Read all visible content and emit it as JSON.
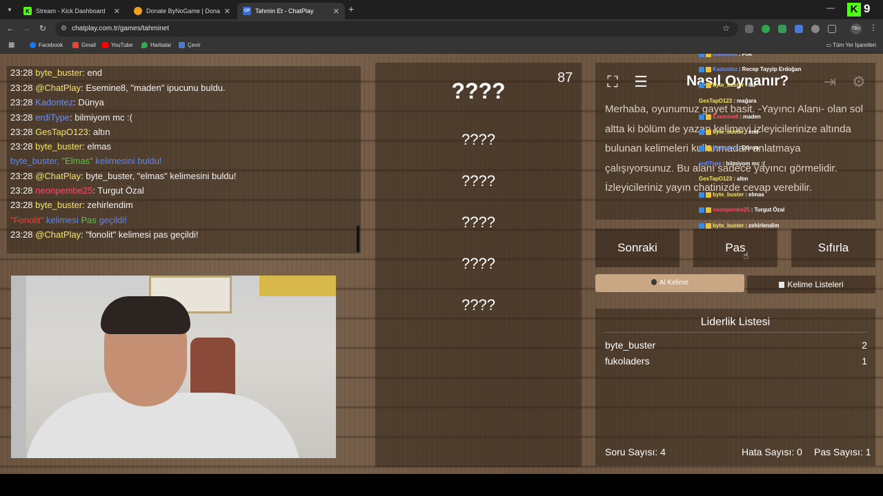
{
  "browser": {
    "tabs": [
      {
        "title": "Stream - Kick Dashboard",
        "icon": "kick-icon",
        "color": "#53fc18",
        "glyph": "K"
      },
      {
        "title": "Donate ByNoGame | Donations",
        "icon": "bynogame-icon",
        "color": "#f0a020",
        "glyph": ""
      },
      {
        "title": "Tahmin Et - ChatPlay",
        "icon": "chatplay-icon",
        "color": "#3a6ad8",
        "glyph": "CP"
      }
    ],
    "new_tab": "+",
    "url": "chatplay.com.tr/games/tahminet",
    "kick_count": "9",
    "profile": "TBU",
    "bookmarks": [
      "Facebook",
      "Gmail",
      "YouTube",
      "Haritalar",
      "Çevir"
    ],
    "all_bookmarks": "Tüm Yer İşaretleri"
  },
  "chat": {
    "lines": [
      {
        "time": "23:28",
        "user": "byte_buster",
        "text": ": end"
      },
      {
        "time": "23:28",
        "user": "@ChatPlay",
        "text": ": Esemine8, \"maden\" ipucunu buldu."
      },
      {
        "time": "23:28",
        "user": "Kadontez",
        "text": ": Dünya"
      },
      {
        "time": "23:28",
        "user": "erdiType",
        "text": ": bilmiyom mc :("
      },
      {
        "time": "23:28",
        "user": "GesTapO123",
        "text": ": altın"
      },
      {
        "time": "23:28",
        "user": "byte_buster",
        "text": ": elmas"
      },
      {
        "time": "",
        "user": "byte_buster, ",
        "text": "kelimesini buldu!",
        "word": "\"Elmas\""
      },
      {
        "time": "23:28",
        "user": "@ChatPlay",
        "text": ": byte_buster, \"elmas\" kelimesini buldu!"
      },
      {
        "time": "23:28",
        "user": "neonpembe25",
        "text": ": Turgut Özal"
      },
      {
        "time": "23:28",
        "user": "byte_buster",
        "text": ": zehirlendim"
      },
      {
        "time": "",
        "user": "\"Fonolit\"",
        "text": "geçildi!",
        "mid": "kelimesi",
        "word": "Pas"
      },
      {
        "time": "23:28",
        "user": "@ChatPlay",
        "text": ": \"fonolit\" kelimesi pas geçildi!"
      }
    ]
  },
  "game": {
    "counter": "87",
    "hidden_words": [
      "????",
      "????",
      "????",
      "????",
      "????",
      "????"
    ],
    "how_title": "Nasıl Oynanır?",
    "how_text": "Merhaba, oyunumuz gayet basit. -Yayıncı Alanı- olan sol altta ki bölüm de yazan kelimeyi izleyicilerinize altında bulunan kelimeleri kullanmadan anlatmaya çalışıyorsunuz. Bu alanı sadece yayıncı görmelidir. İzleyicileriniz yayın chatinizde cevap verebilir.",
    "buttons": {
      "next": "Sonraki",
      "pass": "Pas",
      "reset": "Sıfırla"
    },
    "get_word": "Al Kelime",
    "word_lists": "Kelime Listeleri"
  },
  "leaderboard": {
    "title": "Liderlik Listesi",
    "rows": [
      {
        "name": "byte_buster",
        "score": "2"
      },
      {
        "name": "fukoladers",
        "score": "1"
      }
    ],
    "stats": {
      "questions": "Soru Sayısı: 4",
      "errors": "Hata Sayısı: 0",
      "passes": "Pas Sayısı: 1"
    }
  },
  "overlay": [
    {
      "user": "Kadontez",
      "text": "Fok",
      "color": "#6a8ff0"
    },
    {
      "user": "Kadontez",
      "text": "Recep Tayyip Erdoğan",
      "color": "#6a8ff0"
    },
    {
      "user": "byte_buster",
      "text": "itu",
      "color": "#f2e56a"
    },
    {
      "user": "GesTapO123",
      "text": "mağara",
      "color": "#f2e56a"
    },
    {
      "user": "Esemine8",
      "text": "maden",
      "color": "#ff4a6a"
    },
    {
      "user": "byte_buster",
      "text": "end",
      "color": "#f2e56a"
    },
    {
      "user": "Kadontez",
      "text": "Dünya",
      "color": "#6a8ff0"
    },
    {
      "user": "erdiType",
      "text": "bilmiyom mc :(",
      "color": "#6a8ff0"
    },
    {
      "user": "GesTapO123",
      "text": "altın",
      "color": "#f2e56a"
    },
    {
      "user": "byte_buster",
      "text": "elmas",
      "color": "#f2e56a"
    },
    {
      "user": "neonpembe25",
      "text": "Turgut Özal",
      "color": "#ff4a6a"
    },
    {
      "user": "byte_buster",
      "text": "zehirlendim",
      "color": "#f2e56a"
    }
  ]
}
